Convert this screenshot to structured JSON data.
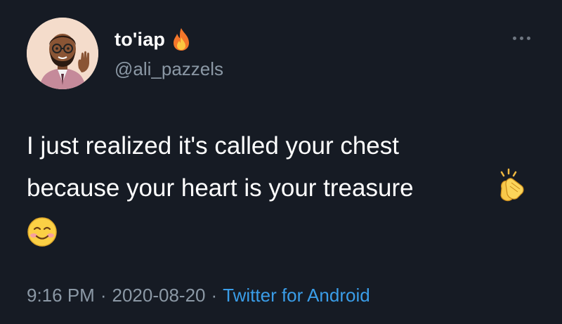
{
  "user": {
    "display_name": "to'iap",
    "handle": "@ali_pazzels",
    "name_emoji": "fire-icon",
    "avatar": "avatar-memoji-waving"
  },
  "tweet": {
    "lines": [
      "I just realized it's called your chest",
      "because your heart is your treasure"
    ],
    "trailing_emojis": [
      "clapping-hands-icon",
      "smiling-face-icon"
    ]
  },
  "meta": {
    "time": "9:16 PM",
    "separator": "·",
    "date": "2020-08-20",
    "source": "Twitter for Android"
  },
  "colors": {
    "background": "#161b24",
    "text": "#ffffff",
    "secondary": "#8b98a5",
    "link": "#3a9de8"
  }
}
